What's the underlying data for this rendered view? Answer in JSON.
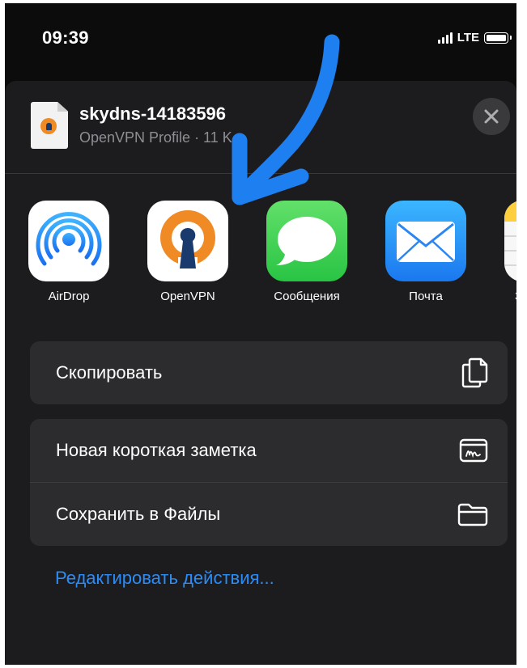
{
  "status_bar": {
    "time": "09:39",
    "network": "LTE"
  },
  "share_sheet": {
    "file": {
      "name": "skydns-14183596",
      "subtitle": "OpenVPN Profile · 11 K"
    },
    "close_label": "×",
    "apps": [
      {
        "label": "AirDrop",
        "icon": "airdrop-icon"
      },
      {
        "label": "OpenVPN",
        "icon": "openvpn-icon"
      },
      {
        "label": "Сообщения",
        "icon": "messages-icon"
      },
      {
        "label": "Почта",
        "icon": "mail-icon"
      },
      {
        "label": "За",
        "icon": "notes-icon"
      }
    ],
    "actions_group1": [
      {
        "label": "Скопировать",
        "icon": "copy-icon"
      }
    ],
    "actions_group2": [
      {
        "label": "Новая короткая заметка",
        "icon": "quick-note-icon"
      },
      {
        "label": "Сохранить в Файлы",
        "icon": "folder-icon"
      }
    ],
    "edit_actions": "Редактировать действия..."
  },
  "colors": {
    "accent": "#2c8cf7",
    "arrow": "#1e7ff0",
    "sheet": "#1c1c1e",
    "cell": "#2c2c2e"
  }
}
